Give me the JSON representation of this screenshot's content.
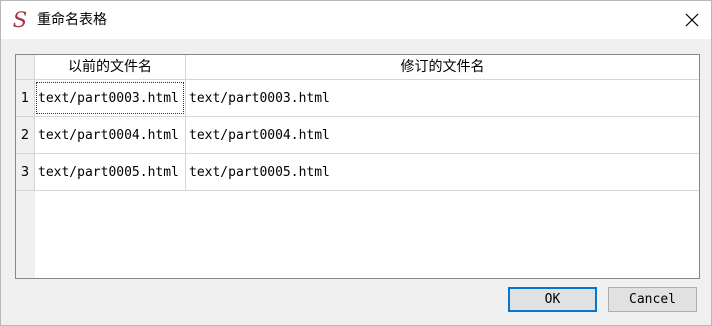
{
  "window": {
    "title": "重命名表格",
    "icon_char": "S",
    "close_glyph": "×"
  },
  "table": {
    "columns": [
      "以前的文件名",
      "修订的文件名"
    ],
    "rows": [
      {
        "num": "1",
        "old": "text/part0003.html",
        "new": "text/part0003.html"
      },
      {
        "num": "2",
        "old": "text/part0004.html",
        "new": "text/part0004.html"
      },
      {
        "num": "3",
        "old": "text/part0005.html",
        "new": "text/part0005.html"
      }
    ]
  },
  "buttons": {
    "ok_label": "OK",
    "cancel_label": "Cancel"
  },
  "colors": {
    "accent": "#0078d7",
    "app_icon": "#a8323e"
  }
}
